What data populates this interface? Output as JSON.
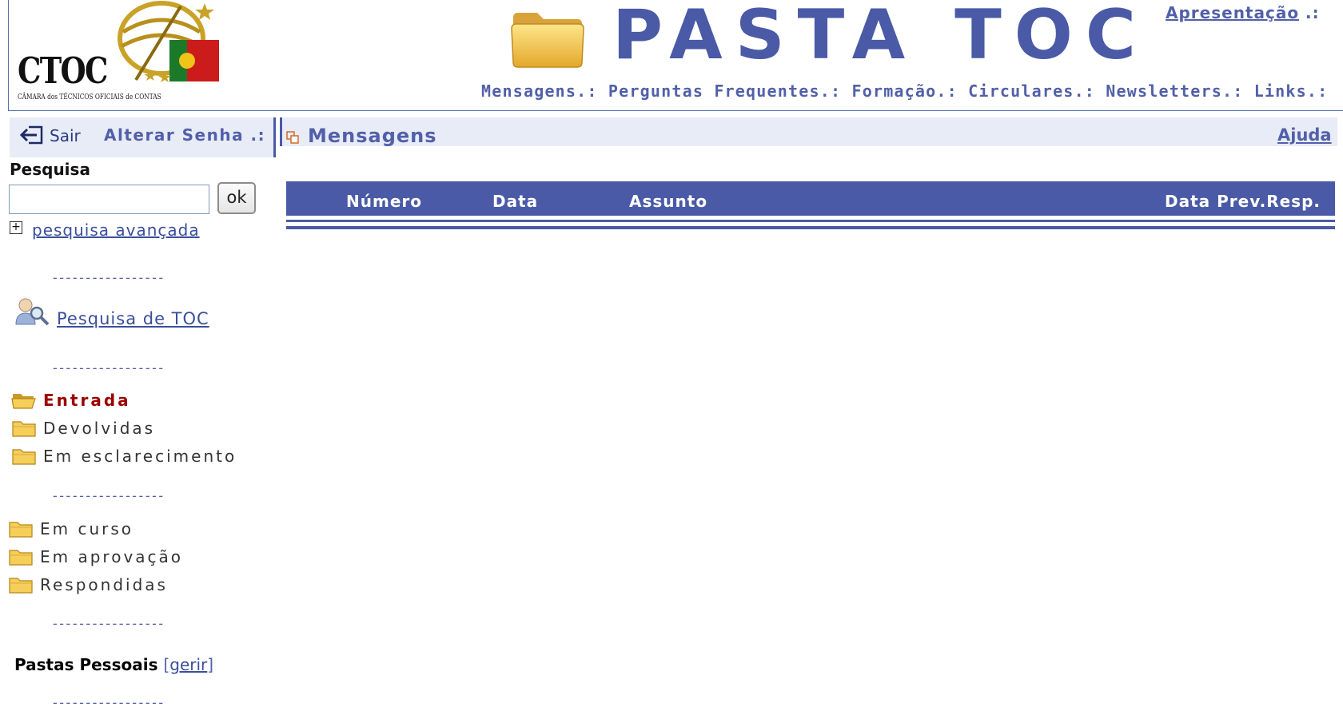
{
  "header": {
    "logo_text": "CTOC",
    "logo_subtitle": "CÂMARA dos TÉCNICOS OFICIAIS de CONTAS",
    "app_title": "PASTA TOC",
    "apresentacao": "Apresentação",
    "apresentacao_sep": ".:",
    "nav": [
      {
        "label": "Mensagens",
        "sep": ".: "
      },
      {
        "label": "Perguntas Frequentes",
        "sep": ".: "
      },
      {
        "label": "Formação",
        "sep": ".: "
      },
      {
        "label": "Circulares",
        "sep": ".: "
      },
      {
        "label": "Newsletters",
        "sep": ".: "
      },
      {
        "label": "Links",
        "sep": ".:"
      }
    ]
  },
  "sidebar": {
    "sair": "Sair",
    "alterar_senha": "Alterar Senha .:",
    "search_label": "Pesquisa",
    "search_value": "",
    "ok": "ok",
    "plus": "+",
    "advanced": "pesquisa avançada",
    "separator": "-----------------",
    "toc_search": "Pesquisa de TOC",
    "folders_group1": [
      "Entrada",
      "Devolvidas",
      "Em esclarecimento"
    ],
    "folders_group2": [
      "Em curso",
      "Em aprovação",
      "Respondidas"
    ],
    "personal_label": "Pastas Pessoais",
    "bracket_open": "[",
    "manage": "gerir",
    "bracket_close": "]"
  },
  "main": {
    "title": "Mensagens",
    "help": "Ajuda",
    "columns": [
      "Número",
      "Data",
      "Assunto",
      "Data Prev.Resp."
    ]
  },
  "colors": {
    "accent": "#4a5aa6",
    "active_folder": "#9b0000",
    "folder_yellow": "#f4c430"
  }
}
